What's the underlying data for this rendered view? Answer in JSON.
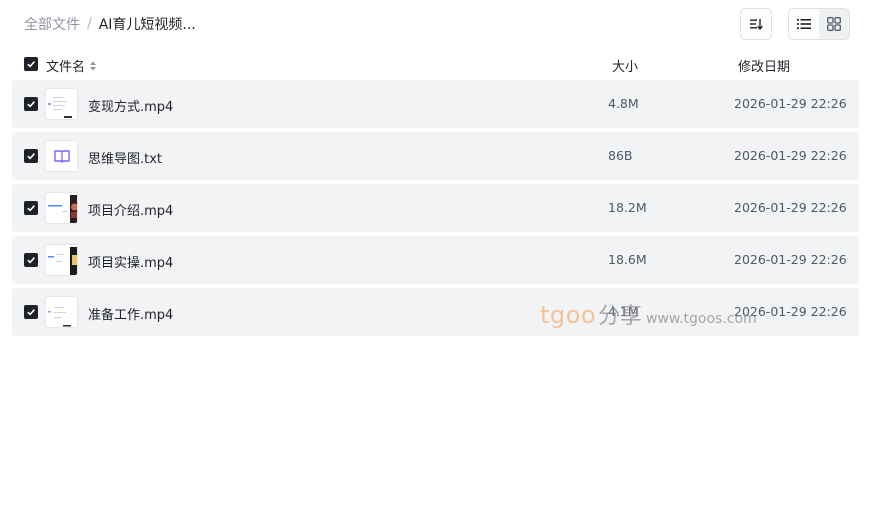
{
  "breadcrumb": {
    "root": "全部文件",
    "separator": "/",
    "current": "AI育儿短视频..."
  },
  "toolbar": {
    "sort_icon": "sort-icon",
    "views": [
      "list-view-icon",
      "grid-view-icon"
    ]
  },
  "table": {
    "headers": {
      "name": "文件名",
      "size": "大小",
      "date": "修改日期"
    },
    "rows": [
      {
        "name": "变现方式.mp4",
        "size": "4.8M",
        "date": "2026-01-29 22:26",
        "kind": "video"
      },
      {
        "name": "思维导图.txt",
        "size": "86B",
        "date": "2026-01-29 22:26",
        "kind": "text"
      },
      {
        "name": "项目介绍.mp4",
        "size": "18.2M",
        "date": "2026-01-29 22:26",
        "kind": "video"
      },
      {
        "name": "项目实操.mp4",
        "size": "18.6M",
        "date": "2026-01-29 22:26",
        "kind": "video"
      },
      {
        "name": "准备工作.mp4",
        "size": "4.1M",
        "date": "2026-01-29 22:26",
        "kind": "video"
      }
    ]
  },
  "watermark": {
    "logo": "tgoo",
    "cn": "分享",
    "url": "www.tgoos.com"
  },
  "colors": {
    "row_bg": "#f2f3f5",
    "checkbox": "#1f2329",
    "text_icon": "#7b61ff"
  }
}
